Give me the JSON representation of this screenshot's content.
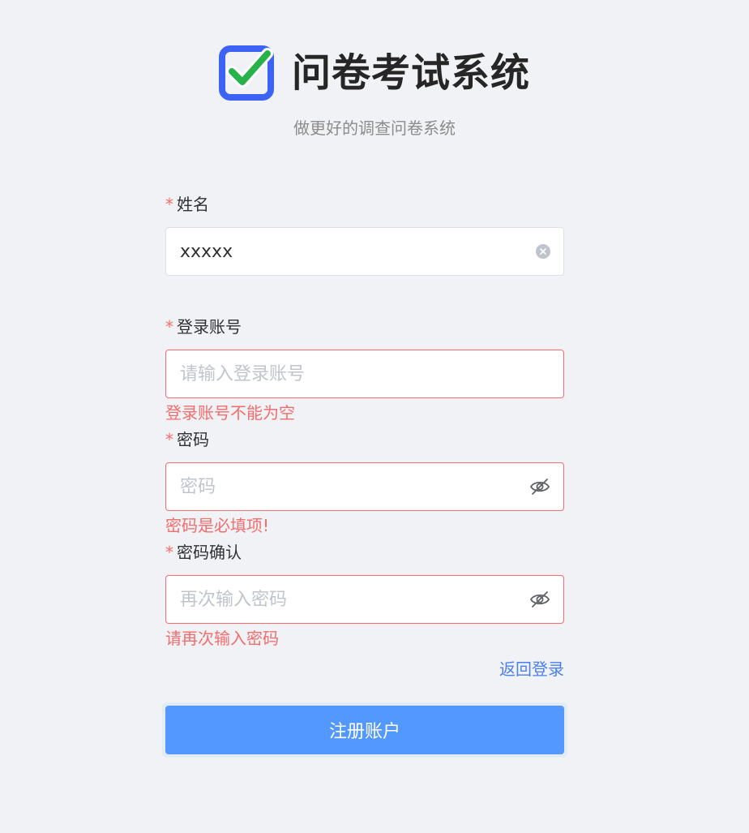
{
  "app": {
    "title": "问卷考试系统",
    "subtitle": "做更好的调查问卷系统"
  },
  "colors": {
    "primary": "#5298ff",
    "link": "#4a7ff0",
    "error": "#f56c6c",
    "logo_blue": "#3d63f5",
    "logo_check": "#27b24a"
  },
  "form": {
    "name": {
      "label": "姓名",
      "value": "xxxxx",
      "placeholder": "",
      "suffix_icon": "clear-icon"
    },
    "account": {
      "label": "登录账号",
      "value": "",
      "placeholder": "请输入登录账号",
      "error": "登录账号不能为空"
    },
    "password": {
      "label": "密码",
      "value": "",
      "placeholder": "密码",
      "error": "密码是必填项!",
      "suffix_icon": "eye-off-icon"
    },
    "confirm_password": {
      "label": "密码确认",
      "value": "",
      "placeholder": "再次输入密码",
      "error": "请再次输入密码",
      "suffix_icon": "eye-off-icon"
    },
    "required_mark": "*"
  },
  "actions": {
    "back_to_login": "返回登录",
    "register": "注册账户"
  }
}
